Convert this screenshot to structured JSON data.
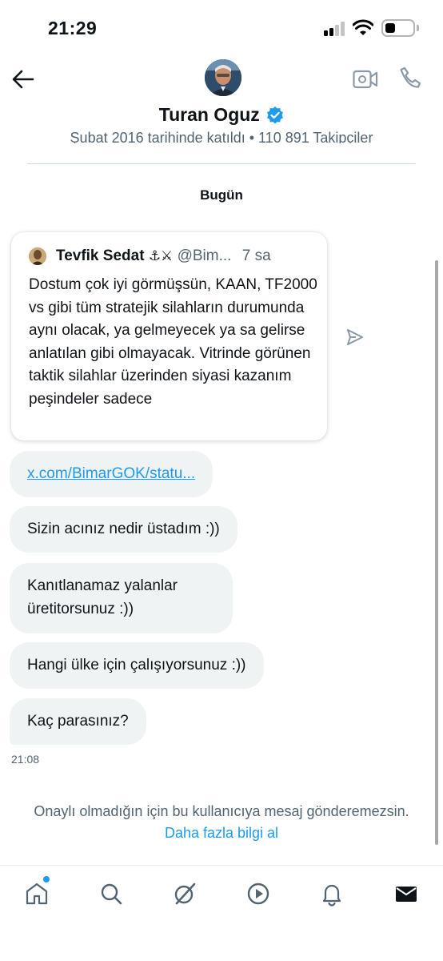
{
  "status_bar": {
    "time": "21:29",
    "icons": [
      "cellular-signal-icon",
      "wifi-icon",
      "battery-icon"
    ]
  },
  "header": {
    "contact_name": "Turan Oguz",
    "verified": true,
    "meta": "Şubat 2016 tarihinde katıldı • 110 891 Takipçiler",
    "icons": [
      "back-arrow-icon",
      "video-call-icon",
      "phone-icon",
      "verified-badge-icon"
    ]
  },
  "conversation": {
    "date_label": "Bugün",
    "quoted_tweet": {
      "author": "Tevfik Sedat",
      "emoji": "⚓⚔",
      "handle": "@Bim...",
      "age": "7 sa",
      "text": "Dostum çok iyi görmüşsün, KAAN, TF2000 vs gibi tüm stratejik silahların durumunda aynı olacak, ya gelmeyecek ya sa gelirse anlatılan gibi olmayacak. Vitrinde görünen taktik silahlar üzerinden siyasi kazanım peşindeler sadece"
    },
    "messages": [
      {
        "text": "x.com/BimarGOK/statu...",
        "type": "link"
      },
      {
        "text": "Sizin acınız nedir üstadım :))",
        "type": "text"
      },
      {
        "text": "Kanıtlanamaz yalanlar üretitorsunuz :))",
        "type": "text"
      },
      {
        "text": "Hangi ülke için çalışıyorsunuz :))",
        "type": "text"
      },
      {
        "text": "Kaç parasınız?",
        "type": "text"
      }
    ],
    "last_message_time": "21:08"
  },
  "notice": {
    "text": "Onaylı olmadığın için bu kullanıcıya mesaj gönderemezsin.",
    "link": "Daha fazla bilgi al"
  },
  "bottom_nav": {
    "items": [
      "home-icon",
      "search-icon",
      "grok-icon",
      "video-icon",
      "notifications-icon",
      "messages-icon"
    ],
    "accent_color": "#1d9bf0"
  }
}
